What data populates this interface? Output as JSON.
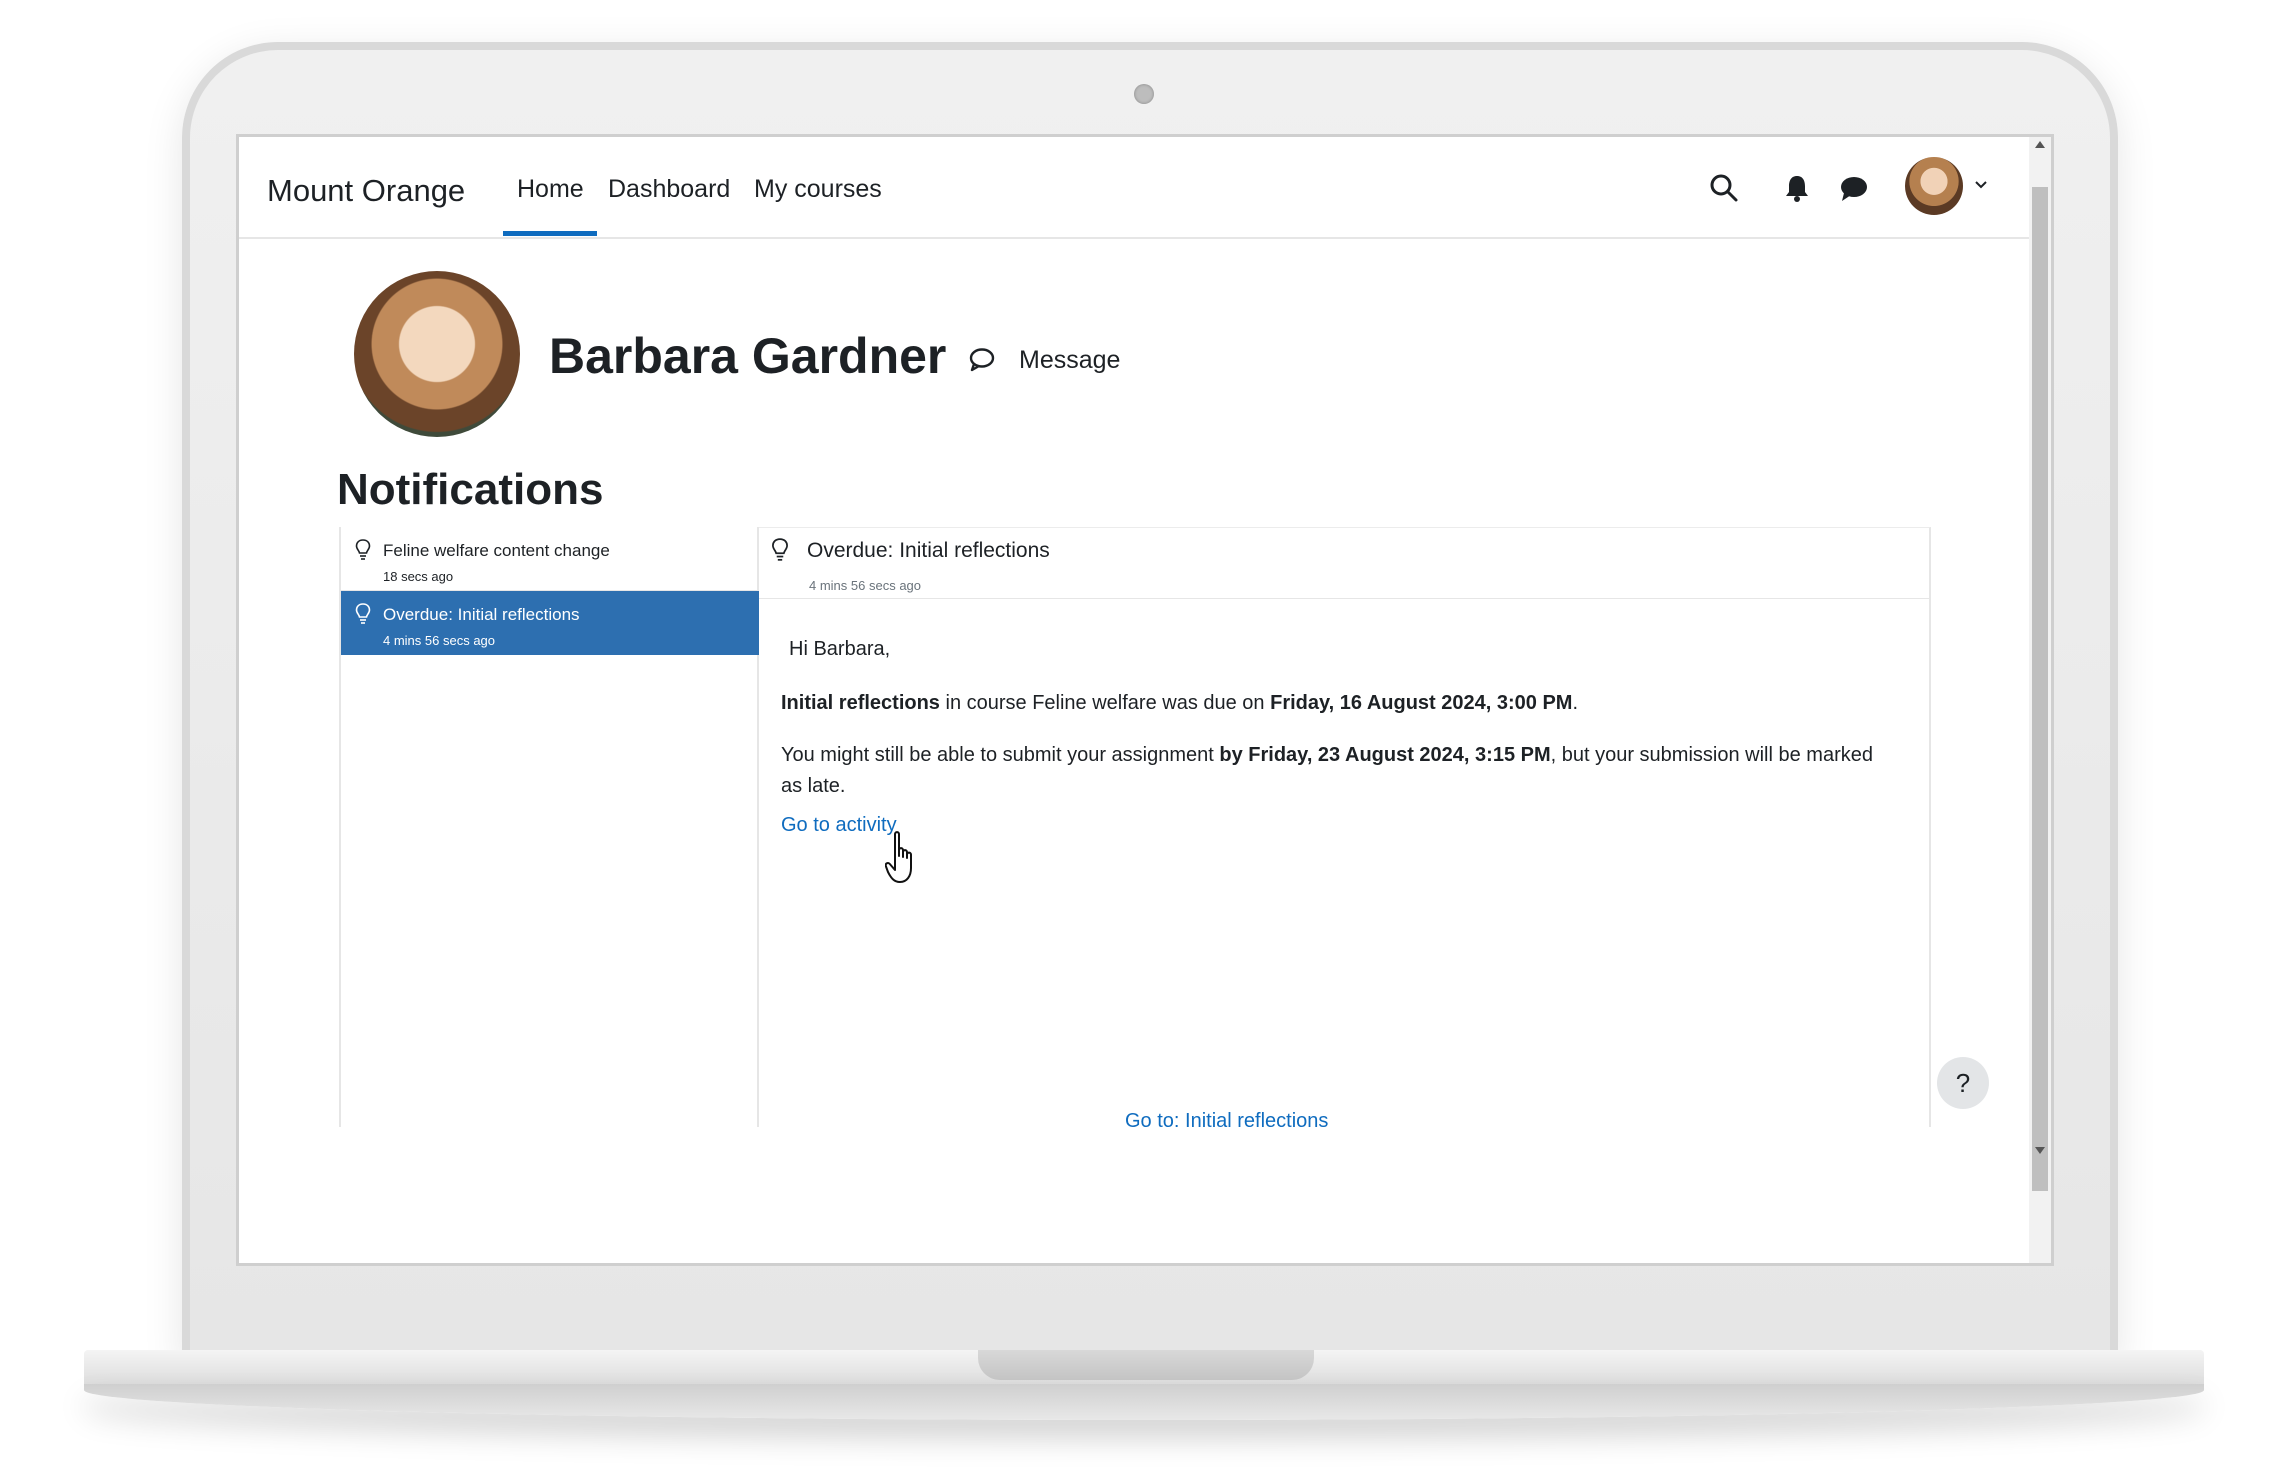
{
  "header": {
    "site_name": "Mount Orange",
    "nav": [
      {
        "label": "Home",
        "active": true
      },
      {
        "label": "Dashboard"
      },
      {
        "label": "My courses"
      }
    ],
    "icons": [
      "search-icon",
      "bell-icon",
      "chat-icon",
      "user-avatar",
      "chevron-down-icon"
    ]
  },
  "profile": {
    "name": "Barbara Gardner",
    "message_label": "Message"
  },
  "page_heading": "Notifications",
  "notifications": [
    {
      "title": "Feline welfare content change",
      "time": "18 secs ago"
    },
    {
      "title": "Overdue: Initial reflections",
      "time": "4 mins 56 secs ago",
      "selected": true
    }
  ],
  "detail": {
    "title": "Overdue: Initial reflections",
    "time": "4 mins 56 secs ago",
    "greeting": "Hi Barbara,",
    "line1": {
      "activity": "Initial reflections",
      "mid": " in course Feline welfare was due on ",
      "due": "Friday, 16 August 2024, 3:00 PM",
      "end": "."
    },
    "line2": {
      "start": "You might still be able to submit your assignment ",
      "deadline": "by Friday, 23 August 2024, 3:15 PM",
      "end": ", but your submission will be marked as late."
    },
    "activity_link": "Go to activity",
    "goto_link": "Go to: Initial reflections"
  },
  "help_label": "?",
  "colors": {
    "accent": "#0f6cbf",
    "selected_bg": "#2d6fb0"
  }
}
